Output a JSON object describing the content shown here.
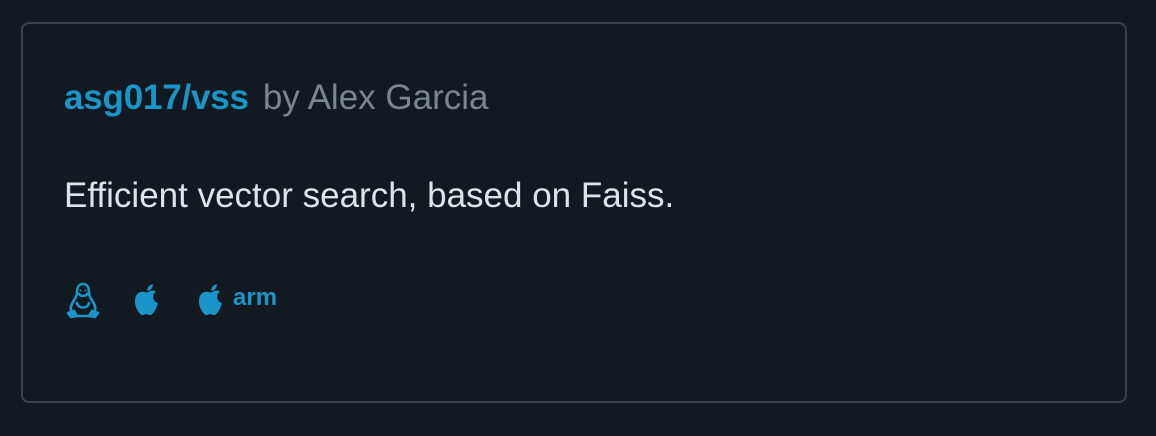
{
  "package": {
    "name": "asg017/vss",
    "author": "by Alex Garcia",
    "description": "Efficient vector search, based on Faiss."
  },
  "platforms": [
    {
      "icon": "linux-icon"
    },
    {
      "icon": "apple-icon"
    },
    {
      "icon": "apple-icon",
      "label": "arm"
    }
  ],
  "colors": {
    "background": "#131920",
    "border": "#3a434d",
    "link": "#1a95c9",
    "muted": "#7a8590",
    "text": "#dfe3e8"
  }
}
